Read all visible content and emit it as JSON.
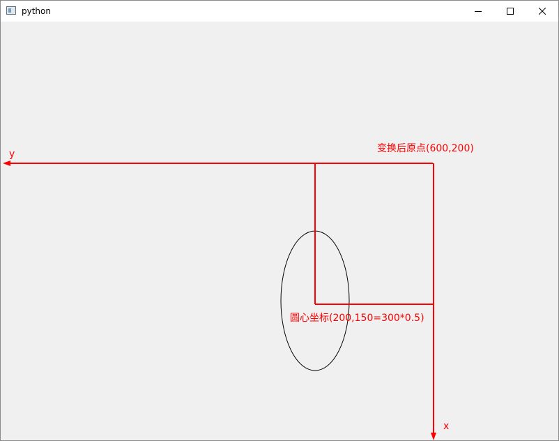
{
  "window": {
    "title": "python",
    "icons": {
      "app": "app-window-icon",
      "minimize": "minimize-icon",
      "maximize": "maximize-icon",
      "close": "close-icon"
    }
  },
  "canvas": {
    "origin_label": "变换后原点(600,200)",
    "center_label": "圆心坐标(200,150=300*0.5)",
    "y_axis_label": "y",
    "x_axis_label": "x",
    "accent_color": "#ff0000",
    "shape_color": "#000000",
    "background": "#f0f0f0"
  }
}
